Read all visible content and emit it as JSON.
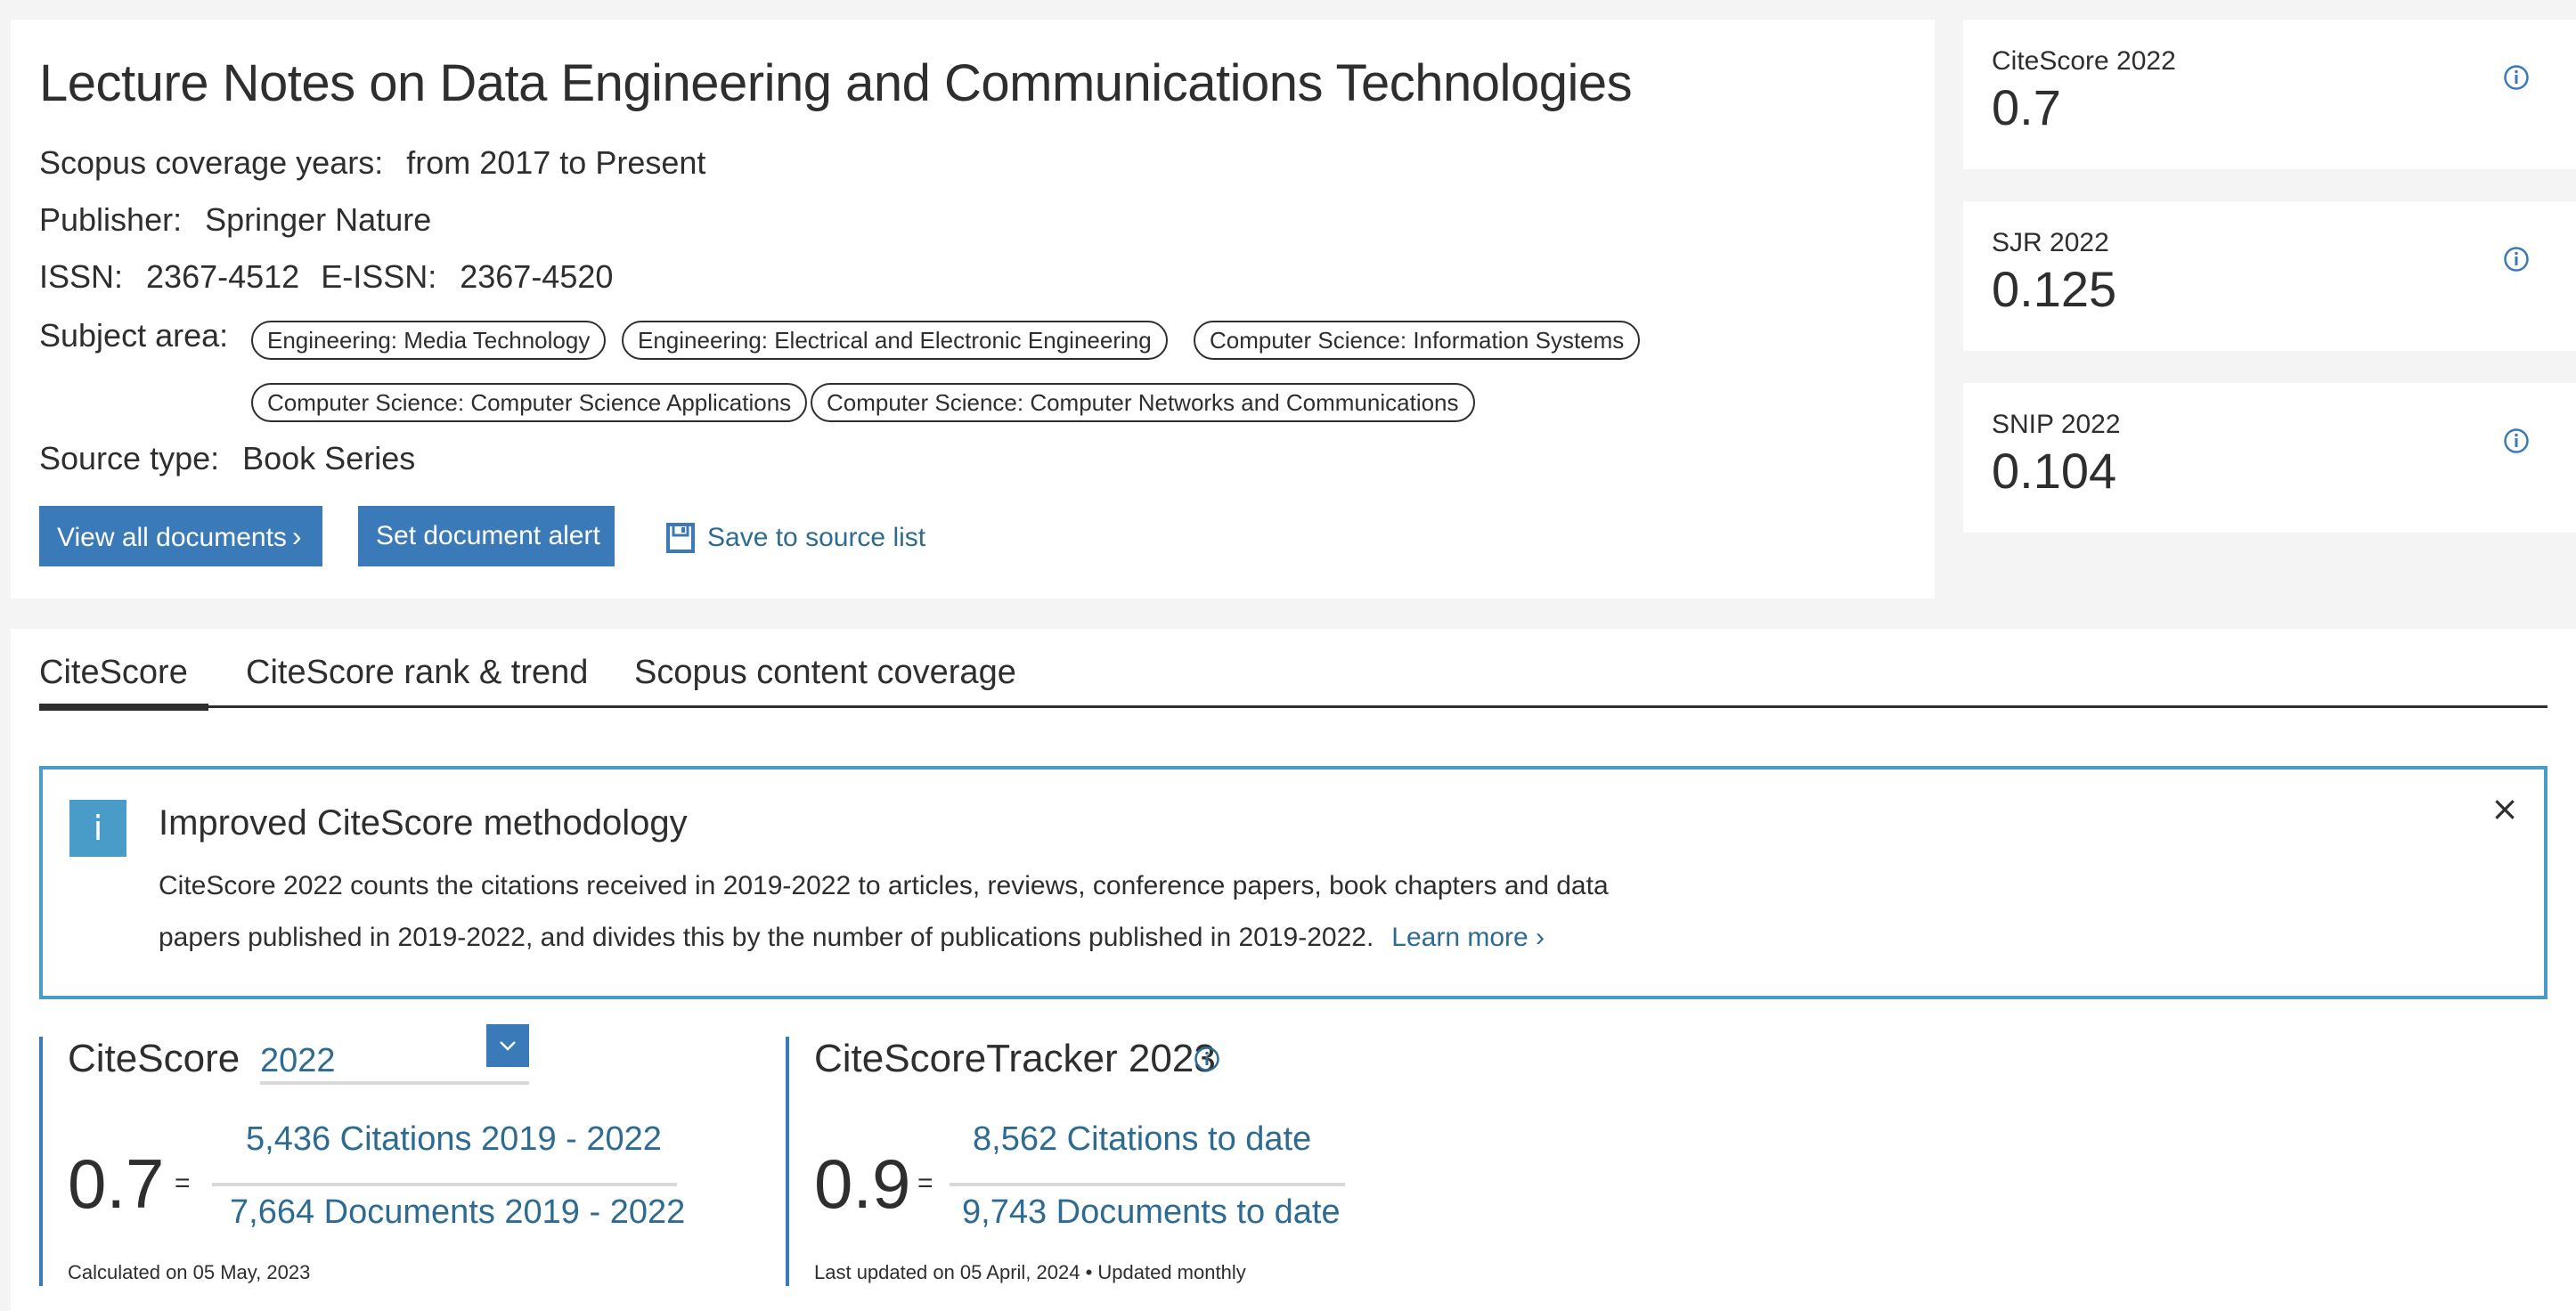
{
  "source": {
    "title": "Lecture Notes on Data Engineering and Communications Technologies",
    "coverage_label": "Scopus coverage years:",
    "coverage_value": "from 2017 to Present",
    "publisher_label": "Publisher:",
    "publisher_value": "Springer Nature",
    "issn_label": "ISSN:",
    "issn_value": "2367-4512",
    "eissn_label": "E-ISSN:",
    "eissn_value": "2367-4520",
    "subject_label": "Subject area:",
    "subjects": [
      "Engineering: Media Technology",
      "Engineering: Electrical and Electronic Engineering",
      "Computer Science: Information Systems",
      "Computer Science: Computer Science Applications",
      "Computer Science: Computer Networks and Communications"
    ],
    "source_type_label": "Source type:",
    "source_type_value": "Book Series"
  },
  "actions": {
    "view_all": "View all documents",
    "view_all_icon": "chevron-right-icon",
    "set_alert": "Set document alert",
    "save_list": "Save to source list",
    "save_icon": "floppy-disk-icon"
  },
  "metrics": [
    {
      "label": "CiteScore 2022",
      "value": "0.7",
      "icon": "info-icon"
    },
    {
      "label": "SJR 2022",
      "value": "0.125",
      "icon": "info-icon"
    },
    {
      "label": "SNIP 2022",
      "value": "0.104",
      "icon": "info-icon"
    }
  ],
  "tabs": [
    {
      "label": "CiteScore",
      "active": true
    },
    {
      "label": "CiteScore rank & trend",
      "active": false
    },
    {
      "label": "Scopus content coverage",
      "active": false
    }
  ],
  "banner": {
    "icon": "i",
    "title": "Improved CiteScore methodology",
    "text": "CiteScore 2022 counts the citations received in 2019-2022 to articles, reviews, conference papers, book chapters and data papers published in 2019-2022, and divides this by the number of publications published in 2019-2022.",
    "learn_more": "Learn more ›",
    "close": "×"
  },
  "citescore": {
    "title": "CiteScore",
    "selected_year": "2022",
    "value": "0.7",
    "equals": "=",
    "numerator": "5,436 Citations 2019 - 2022",
    "denominator": "7,664 Documents 2019 - 2022",
    "footnote": "Calculated on 05 May, 2023"
  },
  "tracker": {
    "title": "CiteScoreTracker 2023",
    "value": "0.9",
    "equals": "=",
    "numerator": "8,562 Citations to date",
    "denominator": "9,743 Documents to date",
    "footnote": "Last updated on 05 April, 2024 • Updated monthly"
  },
  "colors": {
    "primary_button": "#3a7ab8",
    "link": "#2d6b93",
    "banner_border": "#4a9cc8",
    "text": "#2e2e2e",
    "background": "#f4f4f4"
  }
}
